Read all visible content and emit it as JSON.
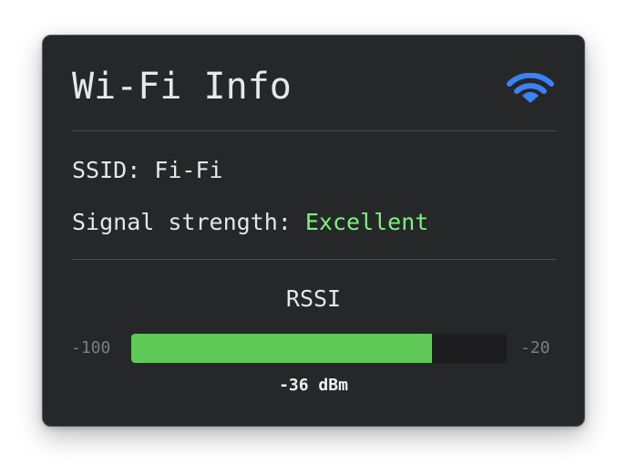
{
  "title": "Wi-Fi Info",
  "icons": {
    "status": "wifi-icon"
  },
  "ssid": {
    "label": "SSID: ",
    "value": "Fi-Fi"
  },
  "signal": {
    "label": "Signal strength: ",
    "value": "Excellent"
  },
  "rssi": {
    "heading": "RSSI",
    "min_label": "-100",
    "max_label": "-20",
    "min": -100,
    "max": -20,
    "value": -36,
    "reading": "-36 dBm"
  },
  "colors": {
    "accent": "#3b82f6",
    "excellent": "#7ef07e",
    "bar_fill": "#5fc856",
    "panel": "#262729"
  }
}
